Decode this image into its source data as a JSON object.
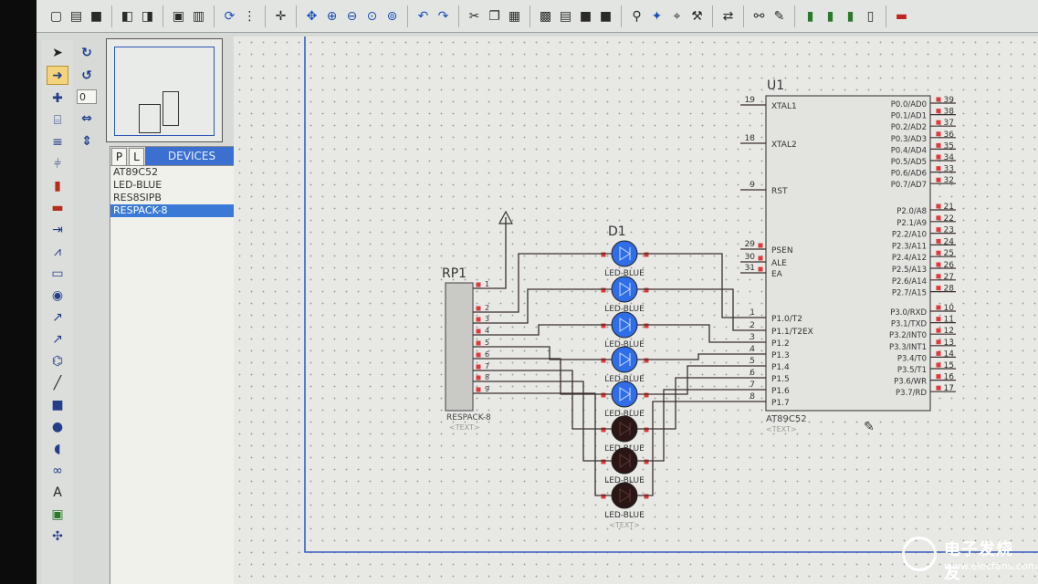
{
  "toolbar": {
    "icons": [
      "new-file",
      "open-folder",
      "save",
      "import",
      "export",
      "print",
      "print-area",
      "refresh",
      "grid",
      "origin",
      "pan",
      "zoom-in",
      "zoom-out",
      "zoom-all",
      "zoom-area",
      "undo",
      "redo",
      "cut",
      "copy",
      "paste",
      "block-copy",
      "block-move",
      "block-rotate",
      "block-delete",
      "pick-device",
      "make-device",
      "package",
      "decompose",
      "wire-autorouter",
      "search-tag",
      "property-assign",
      "netlist",
      "bill-of-materials",
      "electrical-rules",
      "pcb"
    ]
  },
  "side_tools": {
    "icons": [
      "select",
      "component",
      "junction",
      "wire-label",
      "text-script",
      "bus",
      "subcircuit",
      "terminal",
      "device-pin",
      "graph",
      "tape",
      "generator",
      "voltage-probe",
      "current-probe",
      "virtual-instrument",
      "line",
      "box",
      "circle",
      "arc",
      "path",
      "text",
      "symbol",
      "marker"
    ],
    "rotation": {
      "angle_value": "0"
    }
  },
  "devices_panel": {
    "tab_p": "P",
    "tab_l": "L",
    "title": "DEVICES",
    "items": [
      "AT89C52",
      "LED-BLUE",
      "RES8SIPB",
      "RESPACK-8"
    ],
    "selected_index": 3
  },
  "schematic": {
    "u1": {
      "ref": "U1",
      "part": "AT89C52",
      "text_placeholder": "<TEXT>",
      "left_pins": [
        {
          "num": "19",
          "name": "XTAL1"
        },
        {
          "num": "18",
          "name": "XTAL2"
        },
        {
          "num": "9",
          "name": "RST"
        },
        {
          "num": "29",
          "name": "PSEN"
        },
        {
          "num": "30",
          "name": "ALE"
        },
        {
          "num": "31",
          "name": "EA"
        },
        {
          "num": "1",
          "name": "P1.0/T2"
        },
        {
          "num": "2",
          "name": "P1.1/T2EX"
        },
        {
          "num": "3",
          "name": "P1.2"
        },
        {
          "num": "4",
          "name": "P1.3"
        },
        {
          "num": "5",
          "name": "P1.4"
        },
        {
          "num": "6",
          "name": "P1.5"
        },
        {
          "num": "7",
          "name": "P1.6"
        },
        {
          "num": "8",
          "name": "P1.7"
        }
      ],
      "right_pins": [
        {
          "num": "39",
          "name": "P0.0/AD0"
        },
        {
          "num": "38",
          "name": "P0.1/AD1"
        },
        {
          "num": "37",
          "name": "P0.2/AD2"
        },
        {
          "num": "36",
          "name": "P0.3/AD3"
        },
        {
          "num": "35",
          "name": "P0.4/AD4"
        },
        {
          "num": "34",
          "name": "P0.5/AD5"
        },
        {
          "num": "33",
          "name": "P0.6/AD6"
        },
        {
          "num": "32",
          "name": "P0.7/AD7"
        },
        {
          "num": "21",
          "name": "P2.0/A8"
        },
        {
          "num": "22",
          "name": "P2.1/A9"
        },
        {
          "num": "23",
          "name": "P2.2/A10"
        },
        {
          "num": "24",
          "name": "P2.3/A11"
        },
        {
          "num": "25",
          "name": "P2.4/A12"
        },
        {
          "num": "26",
          "name": "P2.5/A13"
        },
        {
          "num": "27",
          "name": "P2.6/A14"
        },
        {
          "num": "28",
          "name": "P2.7/A15"
        },
        {
          "num": "10",
          "name": "P3.0/RXD"
        },
        {
          "num": "11",
          "name": "P3.1/TXD"
        },
        {
          "num": "12",
          "name": "P3.2/INT0"
        },
        {
          "num": "13",
          "name": "P3.3/INT1"
        },
        {
          "num": "14",
          "name": "P3.4/T0"
        },
        {
          "num": "15",
          "name": "P3.5/T1"
        },
        {
          "num": "16",
          "name": "P3.6/WR"
        },
        {
          "num": "17",
          "name": "P3.7/RD"
        }
      ]
    },
    "rp1": {
      "ref": "RP1",
      "part": "RESPACK-8",
      "text_placeholder": "<TEXT>",
      "pins": [
        "1",
        "2",
        "3",
        "4",
        "5",
        "6",
        "7",
        "8",
        "9"
      ]
    },
    "leds": {
      "ref": "D1",
      "part": "LED-BLUE",
      "text_placeholder": "<TEXT>",
      "states": [
        "on",
        "on",
        "on",
        "on",
        "on",
        "off",
        "off",
        "off"
      ]
    },
    "colors": {
      "led_on": "#2f6ee8",
      "led_off": "#2a1614",
      "wire": "#3a2e2e",
      "pin_marker": "#e0383a",
      "sheet_border": "#3a5fc4"
    }
  },
  "watermark": {
    "brand_cn": "电子发烧友",
    "url": "www.elecfans.com"
  }
}
